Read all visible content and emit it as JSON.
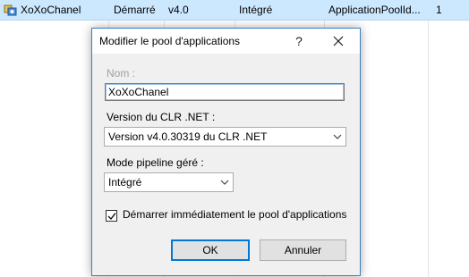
{
  "list_row": {
    "name": "XoXoChanel",
    "status": "Démarré",
    "clr_version": "v4.0",
    "pipeline": "Intégré",
    "identity": "ApplicationPoolId...",
    "apps": "1"
  },
  "dialog": {
    "title": "Modifier le pool d'applications",
    "help_glyph": "?",
    "name_label": "Nom :",
    "name_value": "XoXoChanel",
    "clr_label": "Version du CLR .NET :",
    "clr_selected": "Version v4.0.30319 du CLR .NET",
    "pipeline_label": "Mode pipeline géré :",
    "pipeline_selected": "Intégré",
    "start_checked": true,
    "start_label": "Démarrer immédiatement le pool d'applications",
    "ok_label": "OK",
    "cancel_label": "Annuler"
  },
  "colors": {
    "selection": "#cce8ff",
    "dialog_border": "#3f7fbf",
    "default_button_border": "#0078d7"
  }
}
